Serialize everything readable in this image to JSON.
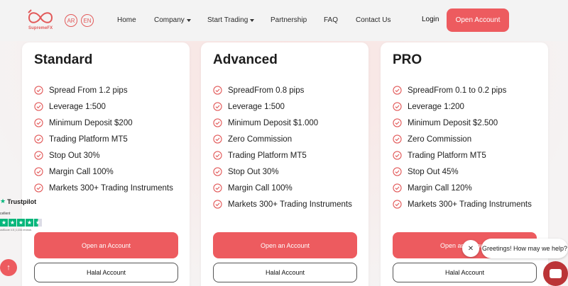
{
  "brand": {
    "name": "SupremeFX",
    "accent": "#ed5b5f"
  },
  "nav": {
    "lang_ar": "AR",
    "lang_en": "EN",
    "links": [
      {
        "label": "Home",
        "dropdown": false
      },
      {
        "label": "Company",
        "dropdown": true
      },
      {
        "label": "Start Trading",
        "dropdown": true
      },
      {
        "label": "Partnership",
        "dropdown": false
      },
      {
        "label": "FAQ",
        "dropdown": false
      },
      {
        "label": "Contact Us",
        "dropdown": false
      }
    ],
    "login": "Login",
    "open_account": "Open Account"
  },
  "plans": [
    {
      "title": "Standard",
      "features": [
        "Spread From 1.2 pips",
        "Leverage 1:500",
        "Minimum Deposit $200",
        "Trading Platform MT5",
        "Stop Out 30%",
        "Margin Call 100%",
        "Markets 300+ Trading Instruments"
      ],
      "open_label": "Open an Account",
      "halal_label": "Halal Account"
    },
    {
      "title": "Advanced",
      "features": [
        "SpreadFrom 0.8 pips",
        "Leverage 1:500",
        "Minimum Deposit $1.000",
        "Zero Commission",
        "Trading Platform MT5",
        "Stop Out 30%",
        "Margin Call 100%",
        "Markets 300+ Trading Instruments"
      ],
      "open_label": "Open an Account",
      "halal_label": "Halal Account"
    },
    {
      "title": "PRO",
      "features": [
        "SpreadFrom 0.1 to 0.2 pips",
        "Leverage 1:200",
        "Minimum Deposit $2.500",
        "Zero Commission",
        "Trading Platform MT5",
        "Stop Out 45%",
        "Margin Call 120%",
        "Markets 300+ Trading Instruments"
      ],
      "open_label": "Open an Account",
      "halal_label": "Halal Account"
    }
  ],
  "trustpilot": {
    "name": "Trustpilot",
    "rating_word": "cellent",
    "score_text": "ustScore 4.5 | 1,034 reviews"
  },
  "chat": {
    "greeting": "Greetings! How may we help?",
    "close_icon": "close-icon",
    "launcher_icon": "chat-icon"
  },
  "scroll_top_icon": "arrow-up-icon"
}
